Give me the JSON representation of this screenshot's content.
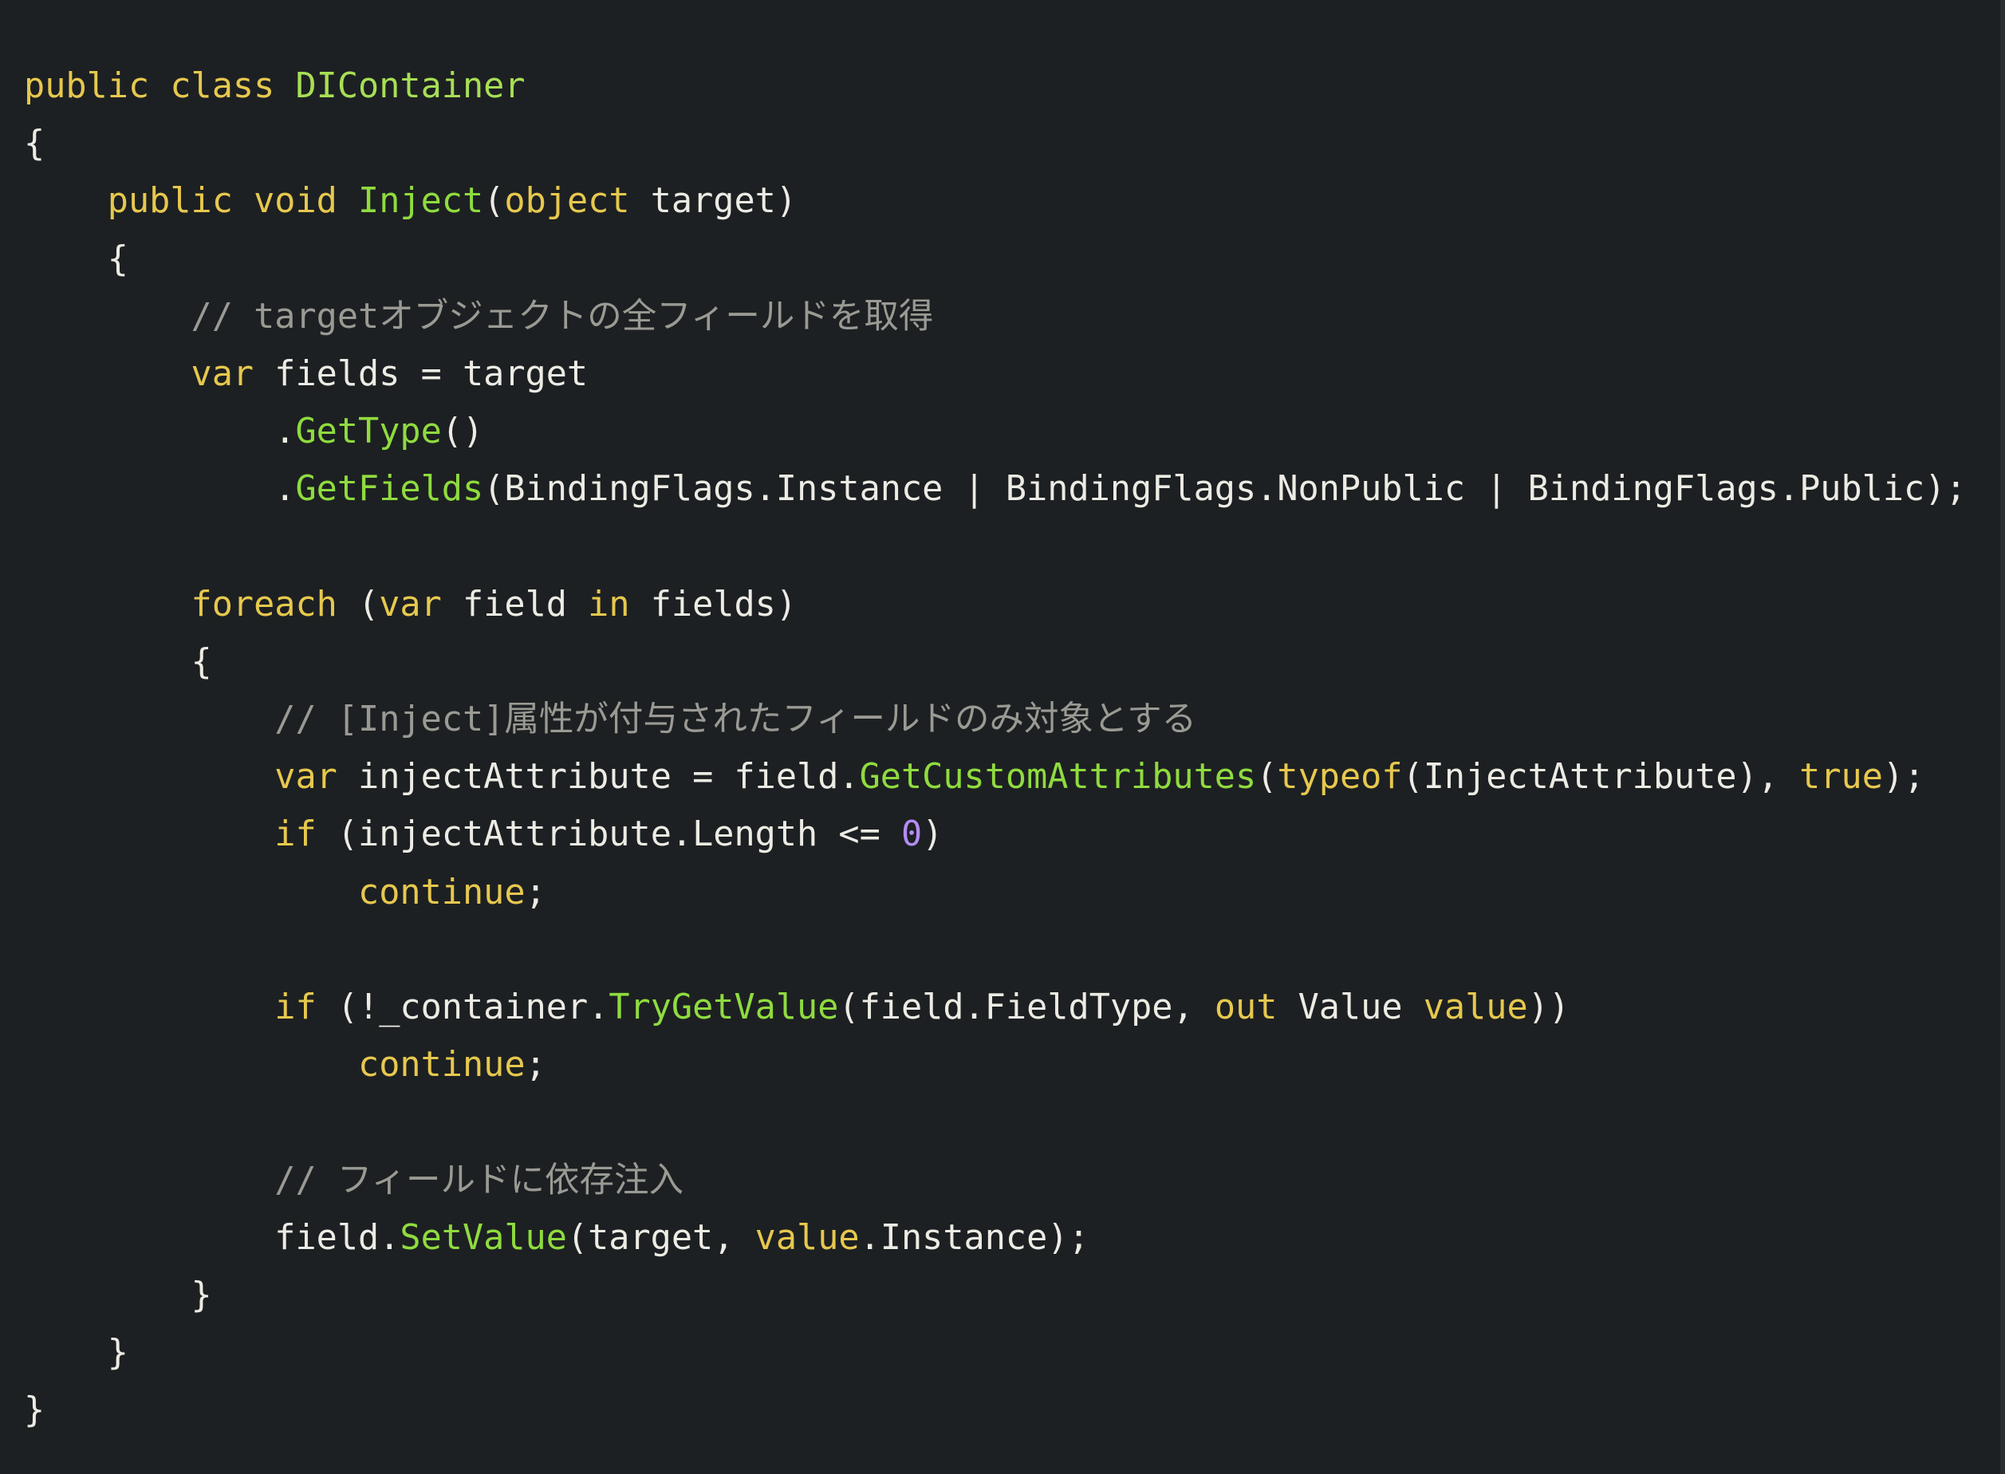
{
  "code": {
    "lines": [
      [
        {
          "t": "public class ",
          "c": "kw"
        },
        {
          "t": "DIContainer",
          "c": "type"
        }
      ],
      [
        {
          "t": "{",
          "c": "plain"
        }
      ],
      [
        {
          "t": "    ",
          "c": "plain"
        },
        {
          "t": "public void ",
          "c": "kw"
        },
        {
          "t": "Inject",
          "c": "fn"
        },
        {
          "t": "(",
          "c": "plain"
        },
        {
          "t": "object",
          "c": "kw"
        },
        {
          "t": " target)",
          "c": "plain"
        }
      ],
      [
        {
          "t": "    {",
          "c": "plain"
        }
      ],
      [
        {
          "t": "        ",
          "c": "plain"
        },
        {
          "t": "// targetオブジェクトの全フィールドを取得",
          "c": "comment"
        }
      ],
      [
        {
          "t": "        ",
          "c": "plain"
        },
        {
          "t": "var",
          "c": "kw"
        },
        {
          "t": " fields = target",
          "c": "plain"
        }
      ],
      [
        {
          "t": "            .",
          "c": "plain"
        },
        {
          "t": "GetType",
          "c": "fn"
        },
        {
          "t": "()",
          "c": "plain"
        }
      ],
      [
        {
          "t": "            .",
          "c": "plain"
        },
        {
          "t": "GetFields",
          "c": "fn"
        },
        {
          "t": "(BindingFlags.Instance | BindingFlags.NonPublic | BindingFlags.Public);",
          "c": "plain"
        }
      ],
      [],
      [
        {
          "t": "        ",
          "c": "plain"
        },
        {
          "t": "foreach",
          "c": "kw"
        },
        {
          "t": " (",
          "c": "plain"
        },
        {
          "t": "var",
          "c": "kw"
        },
        {
          "t": " field ",
          "c": "plain"
        },
        {
          "t": "in",
          "c": "kw"
        },
        {
          "t": " fields)",
          "c": "plain"
        }
      ],
      [
        {
          "t": "        {",
          "c": "plain"
        }
      ],
      [
        {
          "t": "            ",
          "c": "plain"
        },
        {
          "t": "// [Inject]属性が付与されたフィールドのみ対象とする",
          "c": "comment"
        }
      ],
      [
        {
          "t": "            ",
          "c": "plain"
        },
        {
          "t": "var",
          "c": "kw"
        },
        {
          "t": " injectAttribute = field.",
          "c": "plain"
        },
        {
          "t": "GetCustomAttributes",
          "c": "fn"
        },
        {
          "t": "(",
          "c": "plain"
        },
        {
          "t": "typeof",
          "c": "kw"
        },
        {
          "t": "(InjectAttribute), ",
          "c": "plain"
        },
        {
          "t": "true",
          "c": "kw"
        },
        {
          "t": ");",
          "c": "plain"
        }
      ],
      [
        {
          "t": "            ",
          "c": "plain"
        },
        {
          "t": "if",
          "c": "kw"
        },
        {
          "t": " (injectAttribute.Length <= ",
          "c": "plain"
        },
        {
          "t": "0",
          "c": "num"
        },
        {
          "t": ")",
          "c": "plain"
        }
      ],
      [
        {
          "t": "                ",
          "c": "plain"
        },
        {
          "t": "continue",
          "c": "kw"
        },
        {
          "t": ";",
          "c": "plain"
        }
      ],
      [],
      [
        {
          "t": "            ",
          "c": "plain"
        },
        {
          "t": "if",
          "c": "kw"
        },
        {
          "t": " (!_container.",
          "c": "plain"
        },
        {
          "t": "TryGetValue",
          "c": "fn"
        },
        {
          "t": "(field.FieldType, ",
          "c": "plain"
        },
        {
          "t": "out",
          "c": "kw"
        },
        {
          "t": " Value ",
          "c": "plain"
        },
        {
          "t": "value",
          "c": "kw"
        },
        {
          "t": "))",
          "c": "plain"
        }
      ],
      [
        {
          "t": "                ",
          "c": "plain"
        },
        {
          "t": "continue",
          "c": "kw"
        },
        {
          "t": ";",
          "c": "plain"
        }
      ],
      [],
      [
        {
          "t": "            ",
          "c": "plain"
        },
        {
          "t": "// フィールドに依存注入",
          "c": "comment"
        }
      ],
      [
        {
          "t": "            field.",
          "c": "plain"
        },
        {
          "t": "SetValue",
          "c": "fn"
        },
        {
          "t": "(target, ",
          "c": "plain"
        },
        {
          "t": "value",
          "c": "kw"
        },
        {
          "t": ".Instance);",
          "c": "plain"
        }
      ],
      [
        {
          "t": "        }",
          "c": "plain"
        }
      ],
      [
        {
          "t": "    }",
          "c": "plain"
        }
      ],
      [
        {
          "t": "}",
          "c": "plain"
        }
      ]
    ]
  },
  "colors": {
    "background": "#1d2022",
    "keyword": "#e6c84e",
    "type": "#a7de55",
    "method": "#8fdb3f",
    "text": "#ecebe4",
    "comment": "#9a9a94",
    "number": "#b48cf2"
  }
}
